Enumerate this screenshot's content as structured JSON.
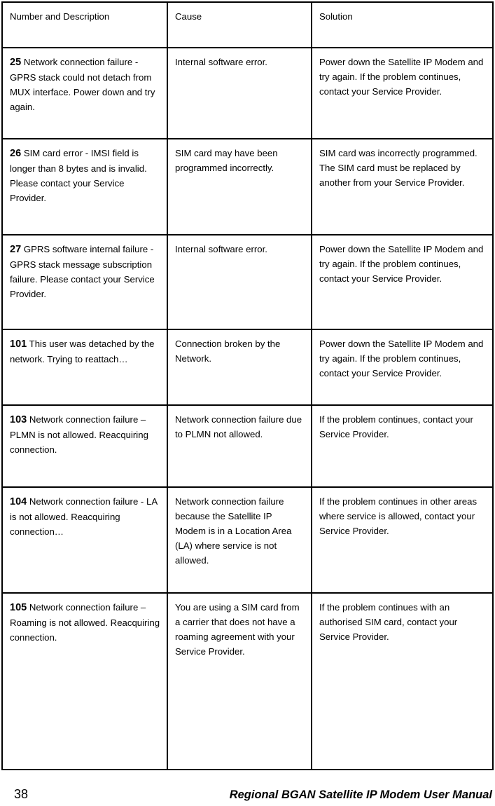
{
  "document": {
    "table": {
      "headers": {
        "number_and_description": "Number and Description",
        "cause": "Cause",
        "solution": "Solution"
      },
      "rows": [
        {
          "code": "25",
          "description": "Network connection failure - GPRS stack could not detach from MUX interface. Power down and try again.",
          "cause": "Internal software error.",
          "solution": "Power down the Satellite IP Modem and try again. If the problem continues, contact your Service Provider."
        },
        {
          "code": "26",
          "description": "SIM card error - IMSI field is longer than 8 bytes and is invalid.  Please contact your Service Provider.",
          "cause": "SIM card may have been programmed incorrectly.",
          "solution": "SIM card was incorrectly programmed. The SIM card must be replaced by another from your Service Provider."
        },
        {
          "code": "27",
          "description": "GPRS software internal failure - GPRS stack message subscription failure.  Please contact your Service Provider.",
          "cause": "Internal software error.",
          "solution": "Power down the Satellite IP Modem and try again. If the problem continues, contact your Service Provider."
        },
        {
          "code": "101",
          "description": "This user was detached by the network. Trying to reattach…",
          "cause": "Connection broken by the Network.",
          "solution": "Power down the Satellite IP Modem and try again. If the problem continues, contact your Service Provider."
        },
        {
          "code": "103",
          "description": "Network connection failure – PLMN is not allowed. Reacquiring connection.",
          "cause": "Network connection failure due to PLMN not allowed.",
          "solution": "If the problem continues, contact your Service Provider."
        },
        {
          "code": "104",
          "description": "Network connection failure - LA is not allowed. Reacquiring connection…",
          "cause": "Network connection failure because the Satellite IP Modem is in a Location Area (LA) where service is not allowed.",
          "solution": "If the problem continues in other areas where service is allowed, contact your Service Provider."
        },
        {
          "code": "105",
          "description": "Network connection failure – Roaming is not allowed. Reacquiring connection.",
          "cause": "You are using a SIM card from a carrier that does not have a roaming agreement with your Service Provider.",
          "solution": "If the problem continues with an authorised SIM card, contact your Service Provider."
        }
      ]
    },
    "footer": {
      "page_number": "38",
      "manual_title": "Regional BGAN Satellite IP Modem User Manual"
    }
  }
}
